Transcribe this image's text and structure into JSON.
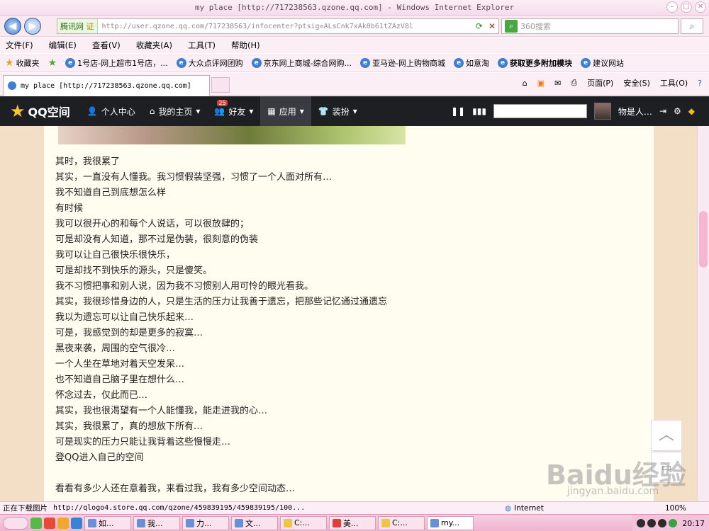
{
  "window": {
    "title": "my place [http://717238563.qzone.qq.com] - Windows Internet Explorer"
  },
  "address": {
    "site_label": "腾讯网",
    "cert_label": "证",
    "url": "http://user.qzone.qq.com/717238563/infocenter?ptsig=ALsCnk7xAk0b61tZAzV8l"
  },
  "search": {
    "placeholder": "360搜索"
  },
  "menu": {
    "items": [
      "文件(F)",
      "编辑(E)",
      "查看(V)",
      "收藏夹(A)",
      "工具(T)",
      "帮助(H)"
    ]
  },
  "favorites": {
    "label": "收藏夹",
    "items": [
      "1号店-网上超市1号店，...",
      "大众点评网团购",
      "京东网上商城-综合网购...",
      "亚马逊-网上购物商城",
      "如意淘",
      "获取更多附加模块",
      "建议网站"
    ]
  },
  "tab": {
    "title": "my place [http://717238563.qzone.qq.com]"
  },
  "commandbar": {
    "page": "页面(P)",
    "safety": "安全(S)",
    "tools": "工具(O)"
  },
  "qzone": {
    "logo": "QQ空间",
    "nav": [
      {
        "label": "个人中心",
        "icon": "person-icon"
      },
      {
        "label": "我的主页",
        "icon": "home-icon"
      },
      {
        "label": "好友",
        "icon": "friends-icon",
        "badge": "25"
      },
      {
        "label": "应用",
        "icon": "apps-icon"
      },
      {
        "label": "装扮",
        "icon": "shirt-icon"
      }
    ],
    "user_name": "物是人…"
  },
  "article": {
    "lines": [
      "其时，我很累了",
      "其实，一直没有人懂我。我习惯假装坚强，习惯了一个人面对所有…",
      "我不知道自己到底想怎么样",
      "有时候",
      "我可以很开心的和每个人说话，可以很放肆的；",
      "可是却没有人知道，那不过是伪装，很刻意的伪装",
      "我可以让自己很快乐很快乐，",
      "可是却找不到快乐的源头，只是傻笑。",
      "我不习惯把事和别人说，因为我不习惯别人用可怜的眼光看我。",
      "其实，我很珍惜身边的人，只是生活的压力让我善于遗忘，把那些记忆通过通遗忘",
      "我以为遗忘可以让自己快乐起来…",
      "可是，我感觉到的却是更多的寂寞…",
      "黑夜来袭，周围的空气很冷…",
      "一个人坐在草地对着天空发呆…",
      "也不知道自己脑子里在想什么…",
      "怀念过去，仅此而已…",
      "其实，我也很渴望有一个人能懂我，能走进我的心…",
      "其实，我很累了，真的想放下所有…",
      "可是现实的压力只能让我背着这些慢慢走…",
      "登QQ进入自己的空间"
    ],
    "after_gap": "看看有多少人还在意着我，来看过我，我有多少空间动态…"
  },
  "watermark": {
    "brand": "Baidu经验",
    "site": "jingyan.baidu.com"
  },
  "status": {
    "left": "正在下载图片",
    "url": "http://qlogo4.store.qq.com/qzone/459839195/459839195/100...",
    "zone": "Internet",
    "zoom": "100%"
  },
  "taskbar": {
    "tasks": [
      "如...",
      "我...",
      "力...",
      "文...",
      "C:...",
      "美...",
      "C:...",
      "my..."
    ],
    "clock": "20:17"
  }
}
